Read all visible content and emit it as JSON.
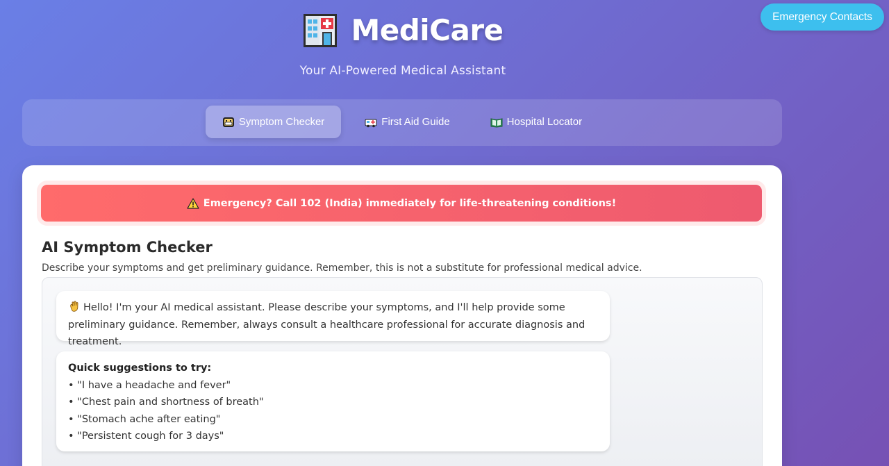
{
  "header": {
    "title": "MediCare",
    "subtitle": "Your AI-Powered Medical Assistant",
    "logo_icon": "hospital-icon"
  },
  "top_actions": {
    "emergency_contacts_label": "Emergency Contacts"
  },
  "nav": {
    "tabs": [
      {
        "label": "Symptom Checker",
        "icon": "mask-face-icon",
        "active": true
      },
      {
        "label": "First Aid Guide",
        "icon": "ambulance-icon",
        "active": false
      },
      {
        "label": "Hospital Locator",
        "icon": "book-icon",
        "active": false
      }
    ]
  },
  "main": {
    "emergency_banner": "Emergency? Call 102 (India) immediately for life-threatening conditions!",
    "section_title": "AI Symptom Checker",
    "section_description": "Describe your symptoms and get preliminary guidance. Remember, this is not a substitute for professional medical advice.",
    "chat": {
      "greeting": "Hello! I'm your AI medical assistant. Please describe your symptoms, and I'll help provide some preliminary guidance. Remember, always consult a healthcare professional for accurate diagnosis and treatment.",
      "suggestions_title": "Quick suggestions to try:",
      "suggestions": [
        "• \"I have a headache and fever\"",
        "• \"Chest pain and shortness of breath\"",
        "• \"Stomach ache after eating\"",
        "• \"Persistent cough for 3 days\""
      ]
    }
  },
  "colors": {
    "banner_start": "#ff6b6b",
    "banner_end": "#ee5a6f",
    "emergency_button": "#3dbfee",
    "bg_start": "#6a7fe6",
    "bg_end": "#7651b4"
  }
}
